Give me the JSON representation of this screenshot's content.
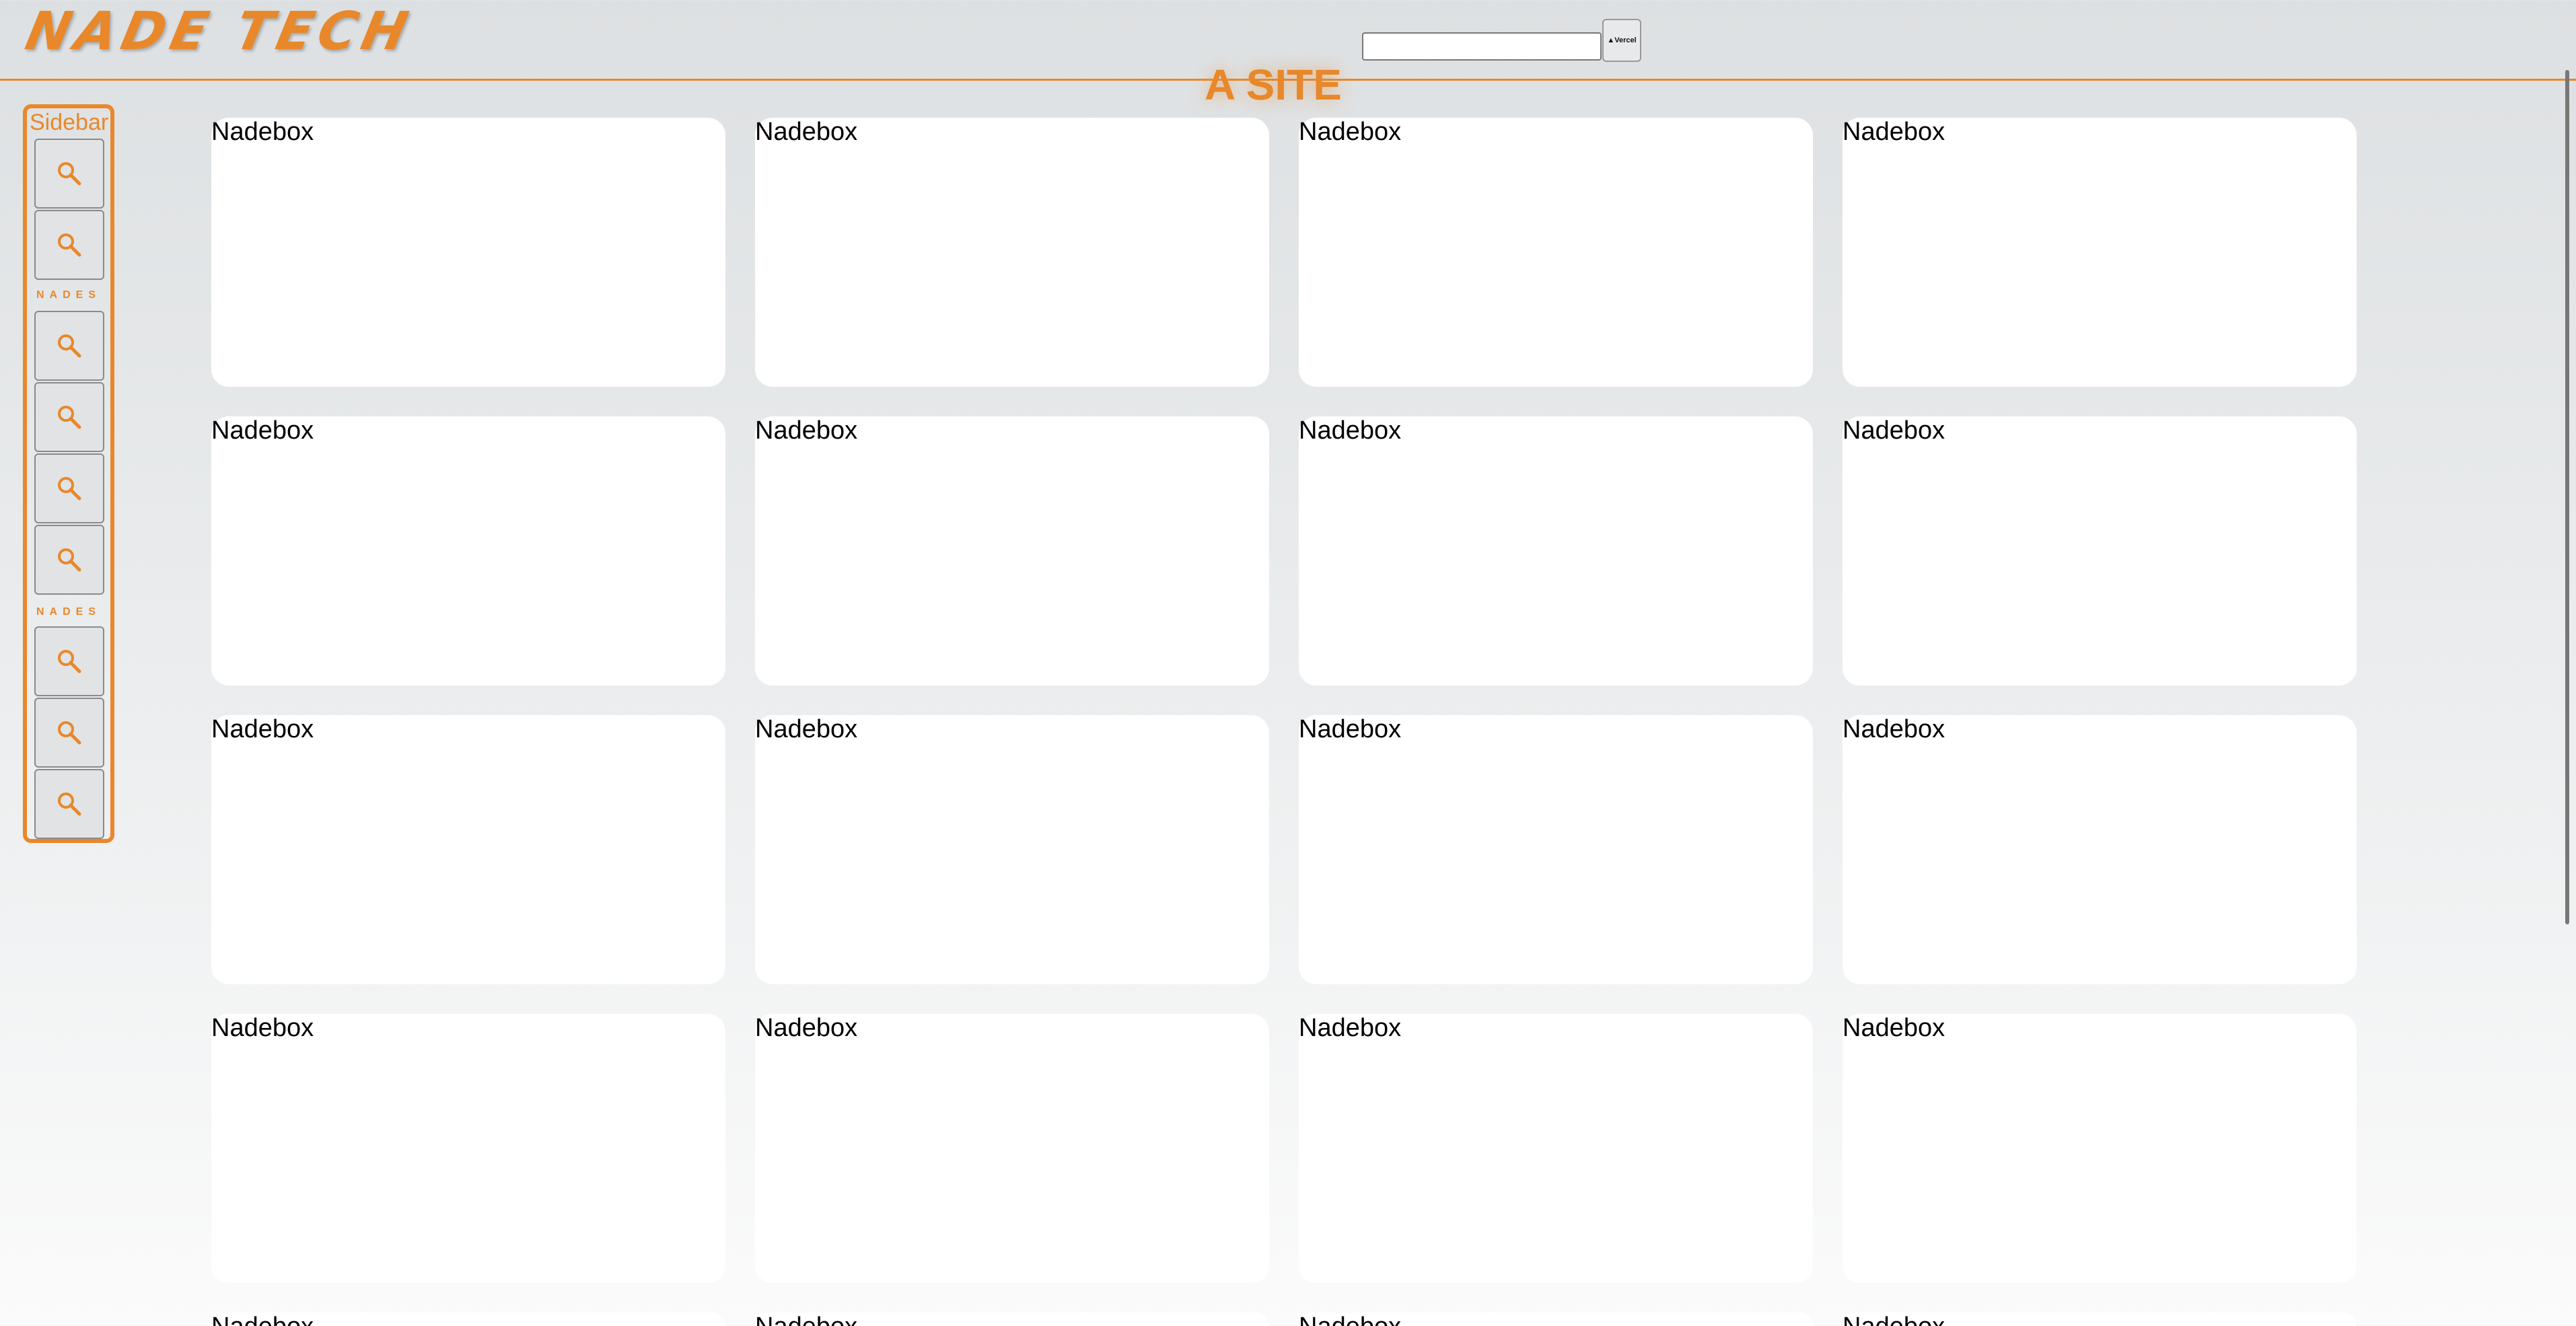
{
  "header": {
    "logo": "NADE TECH",
    "search": {
      "value": "",
      "placeholder": ""
    },
    "vercel_button_label": "▲Vercel",
    "site_title": "A SITE"
  },
  "sidebar": {
    "title": "Sidebar",
    "section_label": "NADES",
    "button_icon": "search-icon",
    "button_count": 9
  },
  "grid": {
    "card_label": "Nadebox",
    "rows": [
      [
        "Nadebox",
        "Nadebox",
        "Nadebox",
        "Nadebox"
      ],
      [
        "Nadebox",
        "Nadebox",
        "Nadebox",
        "Nadebox"
      ],
      [
        "Nadebox",
        "Nadebox",
        "Nadebox",
        "Nadebox"
      ],
      [
        "Nadebox",
        "Nadebox",
        "Nadebox",
        "Nadebox"
      ],
      [
        "Nadebox",
        "Nadebox",
        "Nadebox",
        "Nadebox"
      ]
    ]
  },
  "colors": {
    "accent": "#e8882a",
    "card_bg": "#ffffff",
    "page_bg_top": "#dde0e2",
    "page_bg_bottom": "#fbfbfb"
  }
}
